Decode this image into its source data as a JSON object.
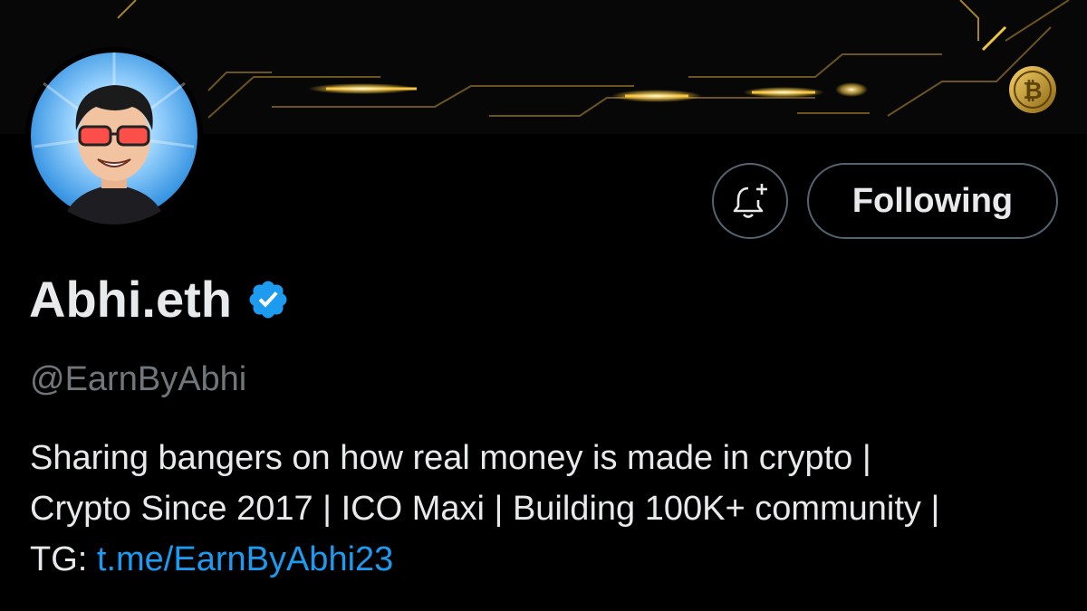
{
  "profile": {
    "display_name": "Abhi.eth",
    "handle": "@EarnByAbhi",
    "verified_icon": "verified-badge-icon",
    "bio_lines": [
      "Sharing bangers on how real money is made in crypto |",
      "Crypto Since 2017 | ICO Maxi | Building 100K+ community |"
    ],
    "bio_link_prefix": "TG: ",
    "bio_link_text": "t.me/EarnByAbhi23"
  },
  "actions": {
    "notify_icon": "bell-plus-icon",
    "following_label": "Following"
  },
  "colors": {
    "background": "#000000",
    "text_primary": "#e7e9ea",
    "text_secondary": "#71767b",
    "link": "#1d9bf0",
    "verified": "#1d9bf0",
    "button_border": "#536471",
    "banner_accent": "#f5c542"
  }
}
